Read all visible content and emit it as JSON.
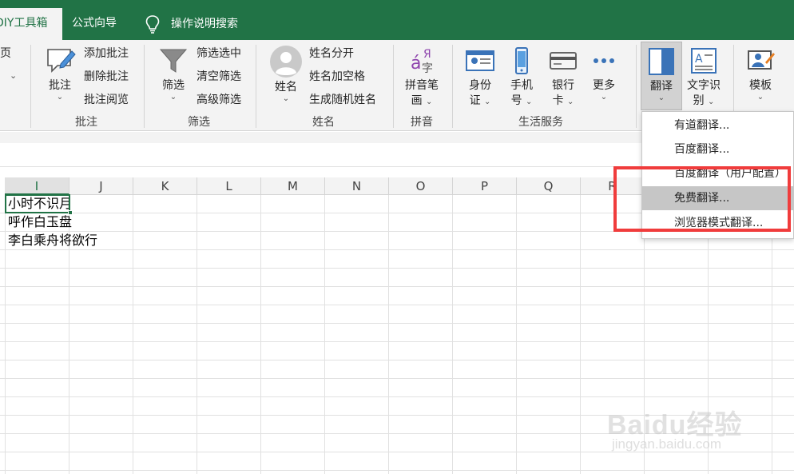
{
  "tabs": {
    "active": "DIY工具箱",
    "formula_wizard": "公式向导",
    "search": "操作说明搜索"
  },
  "ribbon": {
    "page_fragment": {
      "label": "页",
      "chevron": "⌄"
    },
    "comments": {
      "big_button": "批注",
      "items": [
        "添加批注",
        "删除批注",
        "批注阅览"
      ],
      "group": "批注"
    },
    "filter": {
      "big_button": "筛选",
      "items": [
        "筛选选中",
        "清空筛选",
        "高级筛选"
      ],
      "group": "筛选"
    },
    "name": {
      "big_button": "姓名",
      "items": [
        "姓名分开",
        "姓名加空格",
        "生成随机姓名"
      ],
      "group": "姓名"
    },
    "pinyin": {
      "big_button_line1": "拼音笔",
      "big_button_line2": "画",
      "group": "拼音"
    },
    "life": {
      "id_card": [
        "身份",
        "证"
      ],
      "phone": [
        "手机",
        "号"
      ],
      "bank": [
        "银行",
        "卡"
      ],
      "more": "更多",
      "group": "生活服务"
    },
    "translate": "翻译",
    "ocr": [
      "文字识",
      "别"
    ],
    "template": "模板",
    "chevron": "⌄"
  },
  "columns": [
    "I",
    "J",
    "K",
    "L",
    "M",
    "N",
    "O",
    "P",
    "Q",
    "R"
  ],
  "cells": [
    "小时不识月",
    "呼作白玉盘",
    "李白乘舟将欲行"
  ],
  "dropdown": {
    "items": [
      "有道翻译...",
      "百度翻译...",
      "百度翻译（用户配置）",
      "免费翻译...",
      "浏览器模式翻译..."
    ],
    "hovered_index": 3
  },
  "watermark": {
    "main": "Baidu经验",
    "sub": "jingyan.baidu.com"
  },
  "colors": {
    "accent": "#217346",
    "highlight": "#f03c3c",
    "ribbon_bg": "#f3f3f3"
  }
}
